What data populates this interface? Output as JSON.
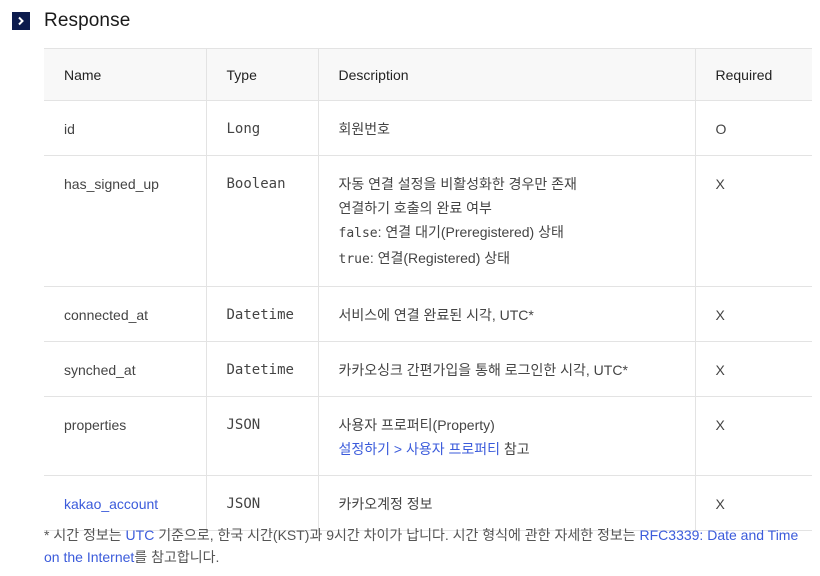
{
  "section": {
    "icon": "chevron-right-icon",
    "title": "Response"
  },
  "table": {
    "headers": {
      "name": "Name",
      "type": "Type",
      "description": "Description",
      "required": "Required"
    },
    "rows": [
      {
        "name": "id",
        "type": "Long",
        "desc1": "회원번호",
        "required": "O"
      },
      {
        "name": "has_signed_up",
        "type": "Boolean",
        "desc1": "자동 연결 설정을 비활성화한 경우만 존재",
        "desc2": "연결하기 호출의 완료 여부",
        "desc3_code": "false",
        "desc3_text": ": 연결 대기(Preregistered) 상태",
        "desc4_code": "true",
        "desc4_text": ": 연결(Registered) 상태",
        "required": "X"
      },
      {
        "name": "connected_at",
        "type": "Datetime",
        "desc1": "서비스에 연결 완료된 시각, UTC*",
        "required": "X"
      },
      {
        "name": "synched_at",
        "type": "Datetime",
        "desc1": "카카오싱크 간편가입을 통해 로그인한 시각, UTC*",
        "required": "X"
      },
      {
        "name": "properties",
        "type": "JSON",
        "desc1": "사용자 프로퍼티(Property)",
        "desc2_link": "설정하기 > 사용자 프로퍼티",
        "desc2_text": " 참고",
        "required": "X"
      },
      {
        "name": "kakao_account",
        "type": "JSON",
        "desc1": "카카오계정 정보",
        "required": "X"
      }
    ]
  },
  "footnote": {
    "t1": "* 시간 정보는 ",
    "link1": "UTC",
    "t2": " 기준으로, 한국 시간(KST)과 9시간 차이가 납니다. 시간 형식에 관한 자세한 정보는 ",
    "link2": "RFC3339: Date and Time on the Internet",
    "t3": "를 참고합니다."
  },
  "colors": {
    "link": "#3b5bdb",
    "icon_bg": "#0c1b4d",
    "header_bg": "#f8f8f8",
    "border": "#e3e3e3"
  }
}
